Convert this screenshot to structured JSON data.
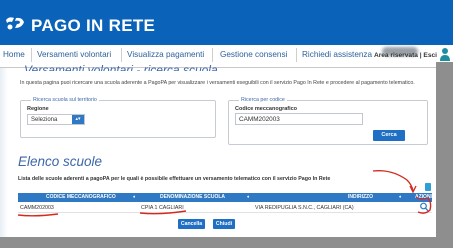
{
  "header": {
    "brand": "PAGO IN RETE",
    "logo_icon": "pagopa-logo-icon",
    "bg_color": "#0a63b8"
  },
  "nav": {
    "items": [
      {
        "label": "Home"
      },
      {
        "label": "Versamenti volontari"
      },
      {
        "label": "Visualizza pagamenti"
      },
      {
        "label": "Gestione consensi"
      },
      {
        "label": "Richiedi assistenza"
      }
    ],
    "reserved_area": "Area riservata | Esci",
    "user_icon": "user-icon"
  },
  "page": {
    "cut_title": "Versamenti volontari - ricerca scuola",
    "intro": "In questa pagina puoi ricercare una scuola aderente a PagoPA per visualizzare i versamenti eseguibili con il servizio Pago In Rete e procedere al pagamento telematico."
  },
  "search_territory": {
    "legend": "Ricerca scuola sul territorio",
    "region_label": "Regione",
    "region_value": "Seleziona"
  },
  "search_code": {
    "legend": "Ricerca per codice",
    "code_label": "Codice meccanografico",
    "code_value": "CAMM202003",
    "search_button": "Cerca"
  },
  "schools": {
    "title": "Elenco scuole",
    "description": "Lista delle scuole aderenti a pagoPA per le quali è possibile effettuare un versamento telematico con il servizio Pago In Rete",
    "columns": [
      "CODICE MECCANOGRAFICO",
      "DENOMINAZIONE SCUOLA",
      "INDIRIZZO",
      "AZIONI"
    ],
    "rows": [
      {
        "code": "CAMM202003",
        "name": "CPIA 1 CAGLIARI",
        "address": "VIA REDIPUGLIA S.N.C., CAGLIARI (CA)",
        "action_icon": "search-icon"
      }
    ],
    "cancel_button": "Cancella",
    "close_button": "Chiudi"
  },
  "colors": {
    "accent": "#2f78c4",
    "annotation": "#d42a1e",
    "link": "#2c5f9b"
  }
}
